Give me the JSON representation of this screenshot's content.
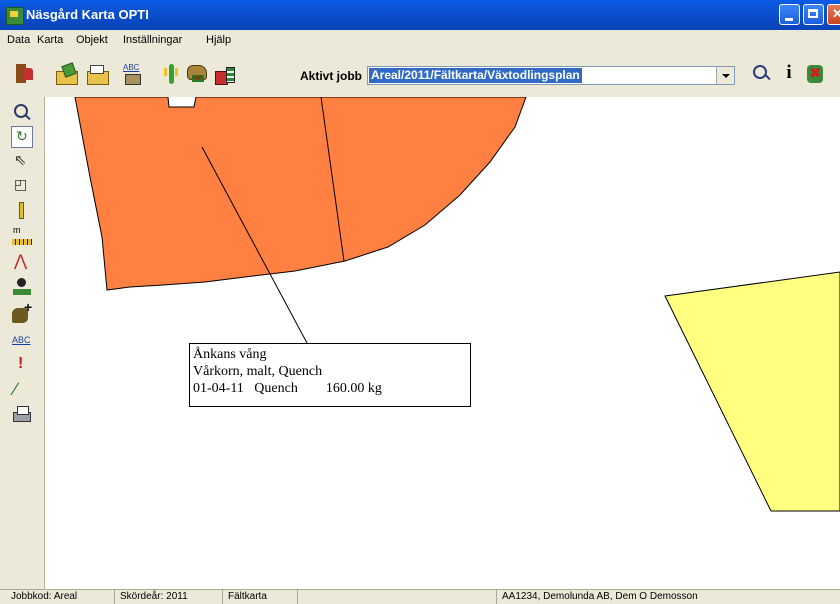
{
  "window": {
    "title": "Näsgård Karta OPTI"
  },
  "menu": [
    "Data",
    "Karta",
    "Objekt",
    "Inställningar",
    "Hjälp"
  ],
  "toolbar": {
    "active_job_label": "Aktivt jobb",
    "active_job_value": "Areal/2011/Fältkarta/Växtodlingsplan",
    "icons": [
      "exit-icon",
      "open-folder-icon",
      "folder-icon",
      "abc-icon",
      "crop-icon",
      "hectare-icon",
      "farm-icon",
      "zoom-icon",
      "info-icon",
      "close-map-icon"
    ]
  },
  "left_tools": [
    "zoom-icon",
    "refresh-icon",
    "pointer-icon",
    "select-area-icon",
    "pencil-icon",
    "ruler-icon",
    "polygon-icon",
    "stamp-icon",
    "add-field-icon",
    "abc-label-icon",
    "warning-icon",
    "split-icon",
    "print-icon"
  ],
  "map": {
    "label_lines": [
      "Ånkans vång",
      "Vårkorn, malt, Quench",
      "01-04-11   Quench        160.00 kg"
    ],
    "colors": {
      "field_orange": "#ff8040",
      "field_yellow": "#ffff80"
    }
  },
  "status": {
    "jobbkod": "Jobbkod: Areal",
    "skordear": "Skördeår: 2011",
    "karta": "Fältkarta",
    "blank": "",
    "owner": "AA1234, Demolunda AB, Dem O Demosson"
  }
}
